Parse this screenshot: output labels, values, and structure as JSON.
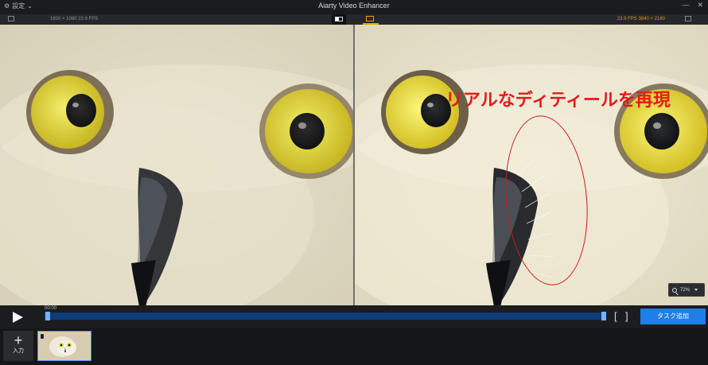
{
  "window": {
    "title": "Aiarty Video Enhancer",
    "settings_label": "設定"
  },
  "left_panel": {
    "meta": "1920 × 1080  23.9 FPS"
  },
  "right_panel": {
    "meta": "23.9 FPS  3840 × 2160"
  },
  "annotation": {
    "text": "リアルなディティールを再現"
  },
  "zoom": {
    "value": "72%"
  },
  "timeline": {
    "time": "00:00",
    "progress": 0.0
  },
  "actions": {
    "task_add_label": "タスク追加"
  },
  "bottom_bar": {
    "add_input_label": "入力"
  },
  "icons": {
    "settings": "gear-icon",
    "minimize": "minimize-icon",
    "close": "close-icon",
    "compare": "compare-toggle-icon",
    "preview": "preview-icon",
    "play": "play-icon",
    "zoom": "magnifier-icon",
    "add": "plus-icon"
  },
  "colors": {
    "accent_blue": "#1f7fe8",
    "highlight_orange": "#e1a300",
    "annotation_red": "#e21b1b"
  }
}
